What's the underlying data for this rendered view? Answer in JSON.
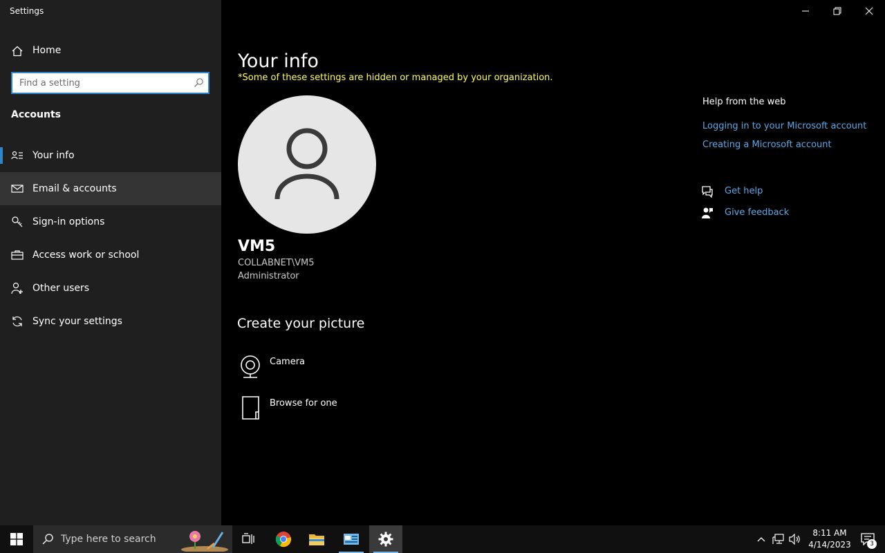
{
  "window": {
    "title": "Settings"
  },
  "sidebar": {
    "home_label": "Home",
    "search_placeholder": "Find a setting",
    "section_title": "Accounts",
    "items": [
      {
        "label": "Your info",
        "icon": "person-list-icon"
      },
      {
        "label": "Email & accounts",
        "icon": "mail-icon"
      },
      {
        "label": "Sign-in options",
        "icon": "key-icon"
      },
      {
        "label": "Access work or school",
        "icon": "briefcase-icon"
      },
      {
        "label": "Other users",
        "icon": "person-add-icon"
      },
      {
        "label": "Sync your settings",
        "icon": "sync-icon"
      }
    ]
  },
  "main": {
    "title": "Your info",
    "notice": "*Some of these settings are hidden or managed by your organization.",
    "user": {
      "name": "VM5",
      "domain": "COLLABNET\\VM5",
      "role": "Administrator"
    },
    "create_picture": {
      "title": "Create your picture",
      "options": [
        {
          "label": "Camera",
          "icon": "camera-icon"
        },
        {
          "label": "Browse for one",
          "icon": "document-icon"
        }
      ]
    }
  },
  "help": {
    "title": "Help from the web",
    "links": [
      "Logging in to your Microsoft account",
      "Creating a Microsoft account"
    ],
    "get_help": "Get help",
    "give_feedback": "Give feedback"
  },
  "taskbar": {
    "search_placeholder": "Type here to search",
    "time": "8:11 AM",
    "date": "4/14/2023",
    "notification_count": "3"
  },
  "colors": {
    "accent": "#2f86c9",
    "link": "#5aa9e6",
    "notice": "#ffff55"
  }
}
